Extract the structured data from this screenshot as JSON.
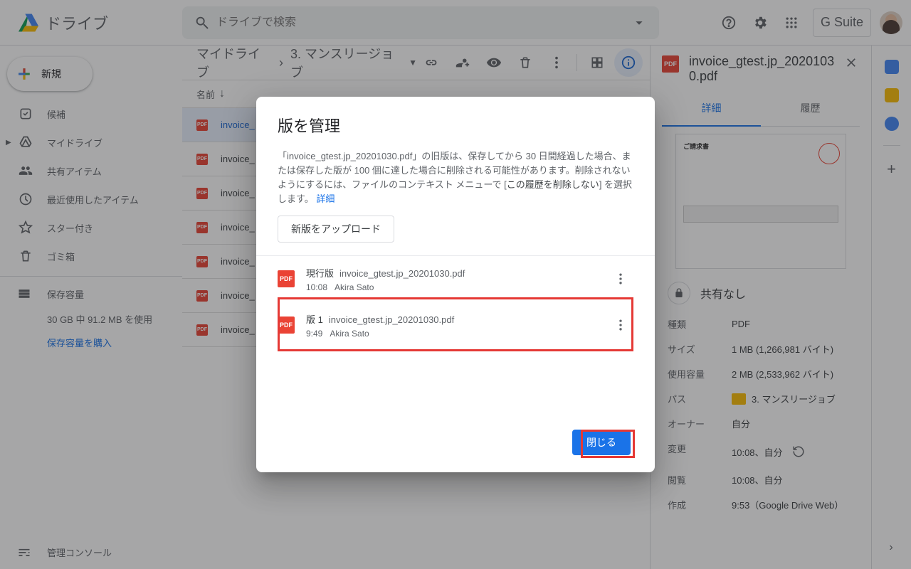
{
  "brand": "ドライブ",
  "search_placeholder": "ドライブで検索",
  "gsuite": "G Suite",
  "new_btn": "新規",
  "nav": {
    "suggest": "候補",
    "mydrive": "マイドライブ",
    "shared": "共有アイテム",
    "recent": "最近使用したアイテム",
    "starred": "スター付き",
    "trash": "ゴミ箱"
  },
  "storage": {
    "title": "保存容量",
    "usage": "30 GB 中 91.2 MB を使用",
    "buy": "保存容量を購入"
  },
  "admin": "管理コンソール",
  "breadcrumbs": {
    "root": "マイドライブ",
    "current": "3. マンスリージョブ"
  },
  "list_header": {
    "name": "名前"
  },
  "files": [
    {
      "name": "invoice_",
      "selected": true
    },
    {
      "name": "invoice_"
    },
    {
      "name": "invoice_"
    },
    {
      "name": "invoice_"
    },
    {
      "name": "invoice_"
    },
    {
      "name": "invoice_"
    },
    {
      "name": "invoice_"
    }
  ],
  "details": {
    "title": "invoice_gtest.jp_20201030.pdf",
    "tabs": {
      "info": "詳細",
      "history": "履歴"
    },
    "share": "共有なし",
    "preview_title": "ご請求書",
    "rows": {
      "type": {
        "k": "種類",
        "v": "PDF"
      },
      "size": {
        "k": "サイズ",
        "v": "1 MB (1,266,981 バイト)"
      },
      "used": {
        "k": "使用容量",
        "v": "2 MB (2,533,962 バイト)"
      },
      "path": {
        "k": "パス",
        "v": "3. マンスリージョブ"
      },
      "owner": {
        "k": "オーナー",
        "v": "自分"
      },
      "modified": {
        "k": "変更",
        "v": "10:08、自分"
      },
      "viewed": {
        "k": "閲覧",
        "v": "10:08、自分"
      },
      "created": {
        "k": "作成",
        "v": "9:53（Google Drive Web）"
      }
    }
  },
  "dialog": {
    "title": "版を管理",
    "desc_a": "「invoice_gtest.jp_20201030.pdf」の旧版は、保存してから 30 日間経過した場合、または保存した版が 100 個に達した場合に削除される可能性があります。削除されないようにするには、ファイルのコンテキスト メニューで [",
    "desc_b": "この履歴を削除しない",
    "desc_c": "] を選択します。 ",
    "desc_link": "詳細",
    "upload": "新版をアップロード",
    "versions": [
      {
        "tag": "現行版",
        "file": "invoice_gtest.jp_20201030.pdf",
        "time": "10:08",
        "user": "Akira Sato"
      },
      {
        "tag": "版 1",
        "file": "invoice_gtest.jp_20201030.pdf",
        "time": "9:49",
        "user": "Akira Sato"
      }
    ],
    "close": "閉じる"
  }
}
